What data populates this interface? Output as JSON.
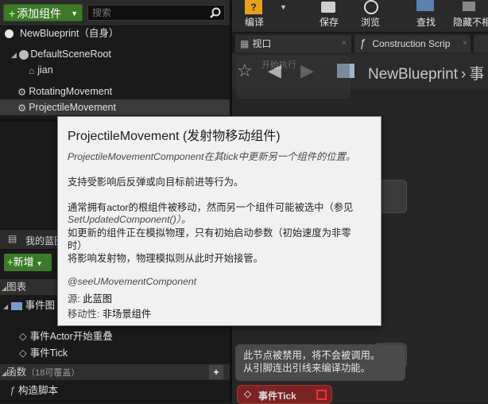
{
  "left_panel": {
    "add_button": "添加组件",
    "search_placeholder": "搜索",
    "tree": [
      "NewBlueprint（自身）",
      "DefaultSceneRoot",
      "jian",
      "RotatingMovement",
      "ProjectileMovement"
    ],
    "my_blueprint_tab": "我的蓝图",
    "new_button": "新增",
    "graph_section": "图表",
    "event_graph": "事件图",
    "events": [
      "事件Actor开始重叠",
      "事件Tick"
    ],
    "functions_section": "函数",
    "functions_override": "（18可覆盖）",
    "construction_script": "构造脚本"
  },
  "toolbar": {
    "buttons": [
      "编译",
      "保存",
      "浏览",
      "查找",
      "隐藏不相"
    ]
  },
  "tabs": [
    "视口",
    "Construction Scrip"
  ],
  "graph": {
    "title": "NewBlueprint",
    "title_suffix": "事",
    "node_hint": "开始执行",
    "disabled_note": [
      "此节点被禁用，将不会被调用。",
      "从引脚连出引线来编译功能。"
    ],
    "event_tick": "事件Tick"
  },
  "tooltip": {
    "title": "ProjectileMovement (发射物移动组件)",
    "line1": "ProjectileMovementComponent在其tick中更新另一个组件的位置。",
    "line2": "支持受影响后反弹或向目标前进等行为。",
    "para": [
      "通常拥有actor的根组件被移动，然而另一个组件可能被选中（参见",
      "SetUpdatedComponent()）。",
      "如更新的组件正在模拟物理，只有初始启动参数（初始速度为非零",
      "时）",
      "将影响发射物，物理模拟则从此时开始接管。"
    ],
    "see": "@seeUMovementComponent",
    "source_label": "源:",
    "source_value": "此蓝图",
    "mobility_label": "移动性:",
    "mobility_value": "非场景组件"
  }
}
